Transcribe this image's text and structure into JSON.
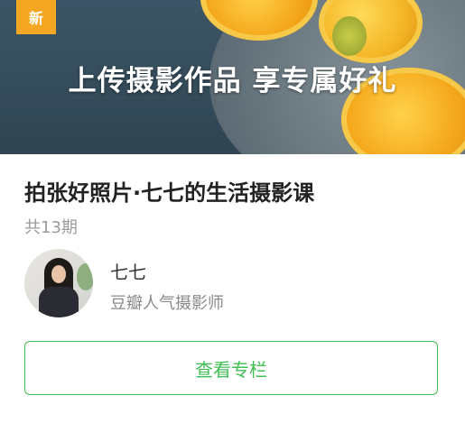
{
  "banner": {
    "badge": "新",
    "headline": "上传摄影作品 享专属好礼"
  },
  "course": {
    "title": "拍张好照片·七七的生活摄影课",
    "episodes": "共13期"
  },
  "author": {
    "name": "七七",
    "title": "豆瓣人气摄影师"
  },
  "cta": {
    "label": "查看专栏"
  },
  "colors": {
    "accent": "#42bd56",
    "badge": "#f5a623"
  }
}
